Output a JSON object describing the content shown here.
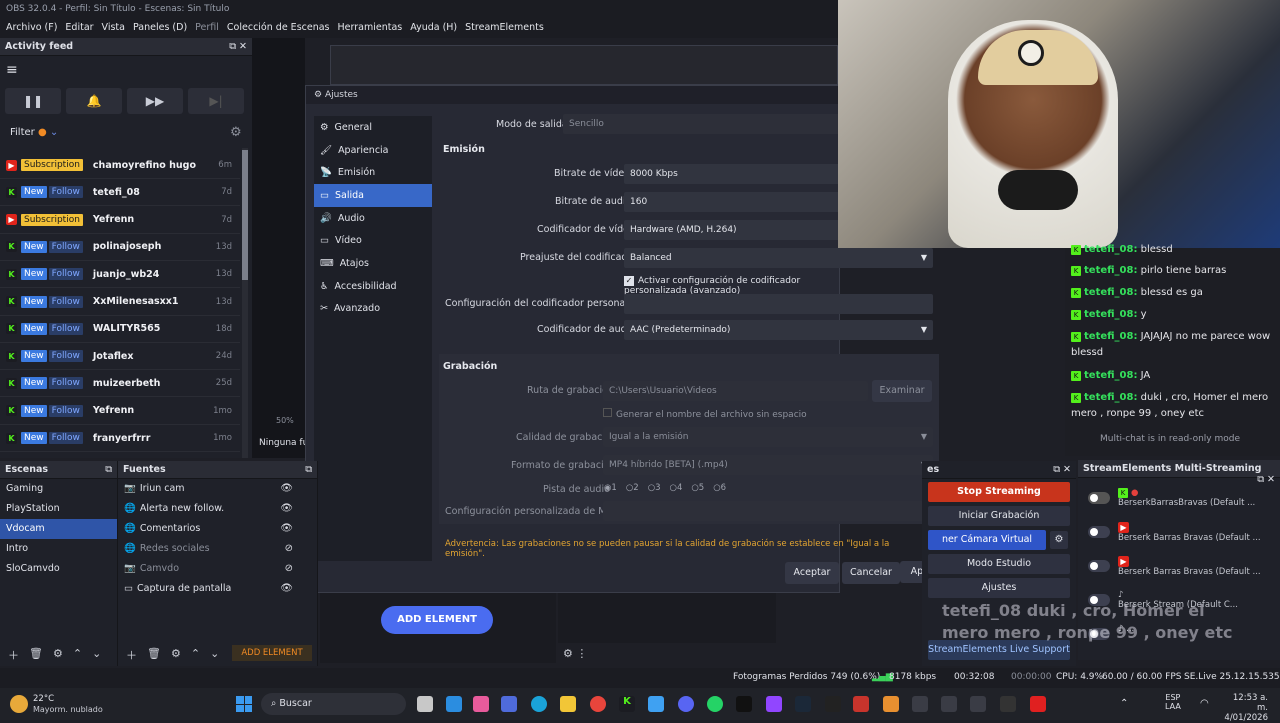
{
  "window": {
    "title": "OBS 32.0.4 - Perfil: Sin Título - Escenas: Sin Título"
  },
  "menu": [
    "Archivo (F)",
    "Editar",
    "Vista",
    "Paneles (D)",
    "Perfil",
    "Colección de Escenas",
    "Herramientas",
    "Ayuda (H)",
    "StreamElements"
  ],
  "activity": {
    "title": "Activity feed",
    "filter": "Filter",
    "items": [
      {
        "platform": "yt",
        "tags": [
          "Subscription"
        ],
        "name": "chamoyrefino hugo",
        "time": "6m"
      },
      {
        "platform": "kick",
        "tags": [
          "New",
          "Follow"
        ],
        "name": "tetefi_08",
        "time": "7d"
      },
      {
        "platform": "yt",
        "tags": [
          "Subscription"
        ],
        "name": "Yefrenn",
        "time": "7d"
      },
      {
        "platform": "kick",
        "tags": [
          "New",
          "Follow"
        ],
        "name": "polinajoseph",
        "time": "13d"
      },
      {
        "platform": "kick",
        "tags": [
          "New",
          "Follow"
        ],
        "name": "juanjo_wb24",
        "time": "13d"
      },
      {
        "platform": "kick",
        "tags": [
          "New",
          "Follow"
        ],
        "name": "XxMilenesasxx1",
        "time": "13d"
      },
      {
        "platform": "kick",
        "tags": [
          "New",
          "Follow"
        ],
        "name": "WALITYR565",
        "time": "18d"
      },
      {
        "platform": "kick",
        "tags": [
          "New",
          "Follow"
        ],
        "name": "Jotaflex",
        "time": "24d"
      },
      {
        "platform": "kick",
        "tags": [
          "New",
          "Follow"
        ],
        "name": "muizeerbeth",
        "time": "25d"
      },
      {
        "platform": "kick",
        "tags": [
          "New",
          "Follow"
        ],
        "name": "Yefrenn",
        "time": "1mo"
      },
      {
        "platform": "kick",
        "tags": [
          "New",
          "Follow"
        ],
        "name": "franyerfrrr",
        "time": "1mo"
      }
    ]
  },
  "settings": {
    "title": "Ajustes",
    "nav": [
      "General",
      "Apariencia",
      "Emisión",
      "Salida",
      "Audio",
      "Vídeo",
      "Atajos",
      "Accesibilidad",
      "Avanzado"
    ],
    "nav_selected": 3,
    "modo_label": "Modo de salida",
    "modo_value": "Sencillo",
    "emision_header": "Emisión",
    "bitrate_video_label": "Bitrate de vídeo",
    "bitrate_video": "8000 Kbps",
    "bitrate_audio_label": "Bitrate de audio",
    "bitrate_audio": "160",
    "codificador_video_label": "Codificador de vídeo",
    "codificador_video": "Hardware (AMD, H.264)",
    "preajuste_label": "Preajuste del codificador",
    "preajuste": "Balanced",
    "custom_check": "Activar configuración de codificador personalizada (avanzado)",
    "custom_label": "Configuración del codificador personalizada",
    "codificador_audio_label": "Codificador de audio",
    "codificador_audio": "AAC (Predeterminado)",
    "grabacion_header": "Grabación",
    "ruta_label": "Ruta de grabación",
    "ruta": "C:\\Users\\Usuario\\Videos",
    "examinar": "Examinar",
    "nombre_check": "Generar el nombre del archivo sin espacio",
    "calidad_label": "Calidad de grabación",
    "calidad": "Igual a la emisión",
    "formato_label": "Formato de grabación",
    "formato": "MP4 híbrido [BETA] (.mp4)",
    "pista_label": "Pista de audio",
    "pistas": [
      "1",
      "2",
      "3",
      "4",
      "5",
      "6"
    ],
    "muxer_label": "Configuración personalizada de Muxer",
    "warning": "Advertencia: Las grabaciones no se pueden pausar si la calidad de grabación se establece en \"Igual a la emisión\".",
    "aceptar": "Aceptar",
    "cancelar": "Cancelar",
    "aplicar": "Aplicar"
  },
  "chat": {
    "messages": [
      {
        "user": "tetefi_08:",
        "text": "blessd"
      },
      {
        "user": "tetefi_08:",
        "text": "pirlo tiene barras"
      },
      {
        "user": "tetefi_08:",
        "text": "blessd es ga"
      },
      {
        "user": "tetefi_08:",
        "text": "y"
      },
      {
        "user": "tetefi_08:",
        "text": "JAJAJAJ no me parece wow blessd"
      },
      {
        "user": "tetefi_08:",
        "text": "JA"
      },
      {
        "user": "tetefi_08:",
        "text": "duki , cro, Homer el mero mero , ronpe 99 , oney etc"
      }
    ],
    "readonly": "Multi-chat is in read-only mode"
  },
  "scenes": {
    "title": "Escenas",
    "items": [
      "Gaming",
      "PlayStation",
      "Vdocam",
      "Intro",
      "SloCamvdo"
    ],
    "selected": 2
  },
  "sources": {
    "title": "Fuentes",
    "items": [
      "Iriun cam",
      "Alerta new follow.",
      "Comentarios",
      "Redes sociales",
      "Camvdo",
      "Captura de pantalla"
    ],
    "add_element": "ADD ELEMENT"
  },
  "preview": {
    "add_element": "ADD ELEMENT",
    "zoom": "50%",
    "ninguna": "Ninguna fu"
  },
  "controls": {
    "stop": "Stop Streaming",
    "grabacion": "Iniciar Grabación",
    "camara": "ner Cámara Virtual",
    "estudio": "Modo Estudio",
    "ajustes": "Ajustes",
    "se_support": "StreamElements Live Support"
  },
  "multistream": {
    "title": "StreamElements Multi-Streaming",
    "rows": [
      "BerserkBarrasBravas (Default ...",
      "Berserk Barras Bravas (Default ...",
      "Berserk Barras Bravas (Default ...",
      "Berserk Stream (Default C...",
      "..."
    ]
  },
  "overlay_text": "tetefi_08  duki , cro, Homer el mero mero , ronpe 99 , oney etc",
  "status": {
    "frames": "Fotogramas Perdidos 749 (0.6%)",
    "kbps": "8178 kbps",
    "rec_time": "00:32:08",
    "time2": "00:00:00",
    "cpu": "CPU: 4.9%",
    "fps": "60.00 / 60.00 FPS",
    "version": "SE.Live 25.12.15.535"
  },
  "taskbar": {
    "temp": "22°C",
    "weather": "Mayorm. nublado",
    "search": "Buscar",
    "lang1": "ESP",
    "lang2": "LAA",
    "time": "12:53 a. m.",
    "date": "4/01/2026"
  }
}
